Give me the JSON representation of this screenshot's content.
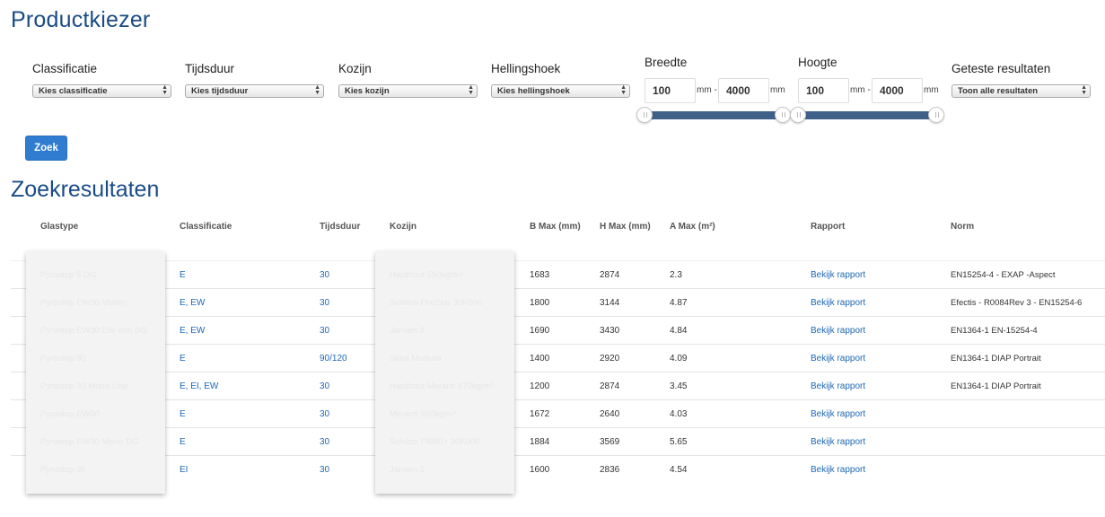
{
  "page_title": "Productkiezer",
  "results_title": "Zoekresultaten",
  "filters": {
    "classificatie": {
      "label": "Classificatie",
      "value": "Kies classificatie"
    },
    "tijdsduur": {
      "label": "Tijdsduur",
      "value": "Kies tijdsduur"
    },
    "kozijn": {
      "label": "Kozijn",
      "value": "Kies kozijn"
    },
    "hellingshoek": {
      "label": "Hellingshoek",
      "value": "Kies hellingshoek"
    },
    "breedte": {
      "label": "Breedte",
      "min": "100",
      "max": "4000",
      "sep_unit": "mm -",
      "unit": "mm",
      "range_fraction": [
        0,
        1
      ]
    },
    "hoogte": {
      "label": "Hoogte",
      "min": "100",
      "max": "4000",
      "sep_unit": "mm -",
      "unit": "mm",
      "range_fraction": [
        0,
        1
      ]
    },
    "geteste_resultaten": {
      "label": "Geteste resultaten",
      "value": "Toon alle resultaten"
    }
  },
  "search_button": "Zoek",
  "table": {
    "headers": [
      "Glastype",
      "Classificatie",
      "Tijdsduur",
      "Kozijn",
      "B Max (mm)",
      "H Max (mm)",
      "A Max (m²)",
      "Rapport",
      "Norm"
    ],
    "rows": [
      {
        "glastype": "Pyrostop 5 DG",
        "classificatie": "E",
        "tijdsduur": "30",
        "kozijn": "Hardhout 550kg/m³",
        "bmax": "1683",
        "hmax": "2874",
        "amax": "2.3",
        "rapport": "Bekijk rapport",
        "norm": "EN15254-4 - EXAP -Aspect"
      },
      {
        "glastype": "Pyrostop EW30 Vision",
        "classificatie": "E, EW",
        "tijdsduur": "30",
        "kozijn": "Schüco FireStar 30K000",
        "bmax": "1800",
        "hmax": "3144",
        "amax": "4.87",
        "rapport": "Bekijk rapport",
        "norm": "Efectis - R0084Rev 3 - EN15254-6"
      },
      {
        "glastype": "Pyrostop EW30 EW mm DG",
        "classificatie": "E, EW",
        "tijdsduur": "30",
        "kozijn": "Jansen 3",
        "bmax": "1690",
        "hmax": "3430",
        "amax": "4.84",
        "rapport": "Bekijk rapport",
        "norm": "EN1364-1 EN-15254-4"
      },
      {
        "glastype": "Pyrostop 90",
        "classificatie": "E",
        "tijdsduur": "90/120",
        "kozijn": "Staal Modular",
        "bmax": "1400",
        "hmax": "2920",
        "amax": "4.09",
        "rapport": "Bekijk rapport",
        "norm": "EN1364-1 DIAP Portrait"
      },
      {
        "glastype": "Pyrostop 30 Mono Line",
        "classificatie": "E, EI, EW",
        "tijdsduur": "30",
        "kozijn": "Hardhout Meranti 670kg/m³",
        "bmax": "1200",
        "hmax": "2874",
        "amax": "3.45",
        "rapport": "Bekijk rapport",
        "norm": "EN1364-1 DIAP Portrait"
      },
      {
        "glastype": "Pyrostop EW30",
        "classificatie": "E",
        "tijdsduur": "30",
        "kozijn": "Meranti 550kg/m³",
        "bmax": "1672",
        "hmax": "2640",
        "amax": "4.03",
        "rapport": "Bekijk rapport",
        "norm": ""
      },
      {
        "glastype": "Pyrostop EW30 Mono DG",
        "classificatie": "E",
        "tijdsduur": "30",
        "kozijn": "Schüco FW50+ 30K000",
        "bmax": "1884",
        "hmax": "3569",
        "amax": "5.65",
        "rapport": "Bekijk rapport",
        "norm": ""
      },
      {
        "glastype": "Pyrostop 30",
        "classificatie": "EI",
        "tijdsduur": "30",
        "kozijn": "Jansen 3",
        "bmax": "1600",
        "hmax": "2836",
        "amax": "4.54",
        "rapport": "Bekijk rapport",
        "norm": ""
      }
    ]
  },
  "colors": {
    "title": "#1a4c86",
    "button": "#2f7cd0",
    "link": "#1d67b4",
    "slider": "#3f6189"
  },
  "icons": {
    "select_arrows": "up-down-chevron-icon",
    "slider_handle": "slider-grip-icon"
  }
}
